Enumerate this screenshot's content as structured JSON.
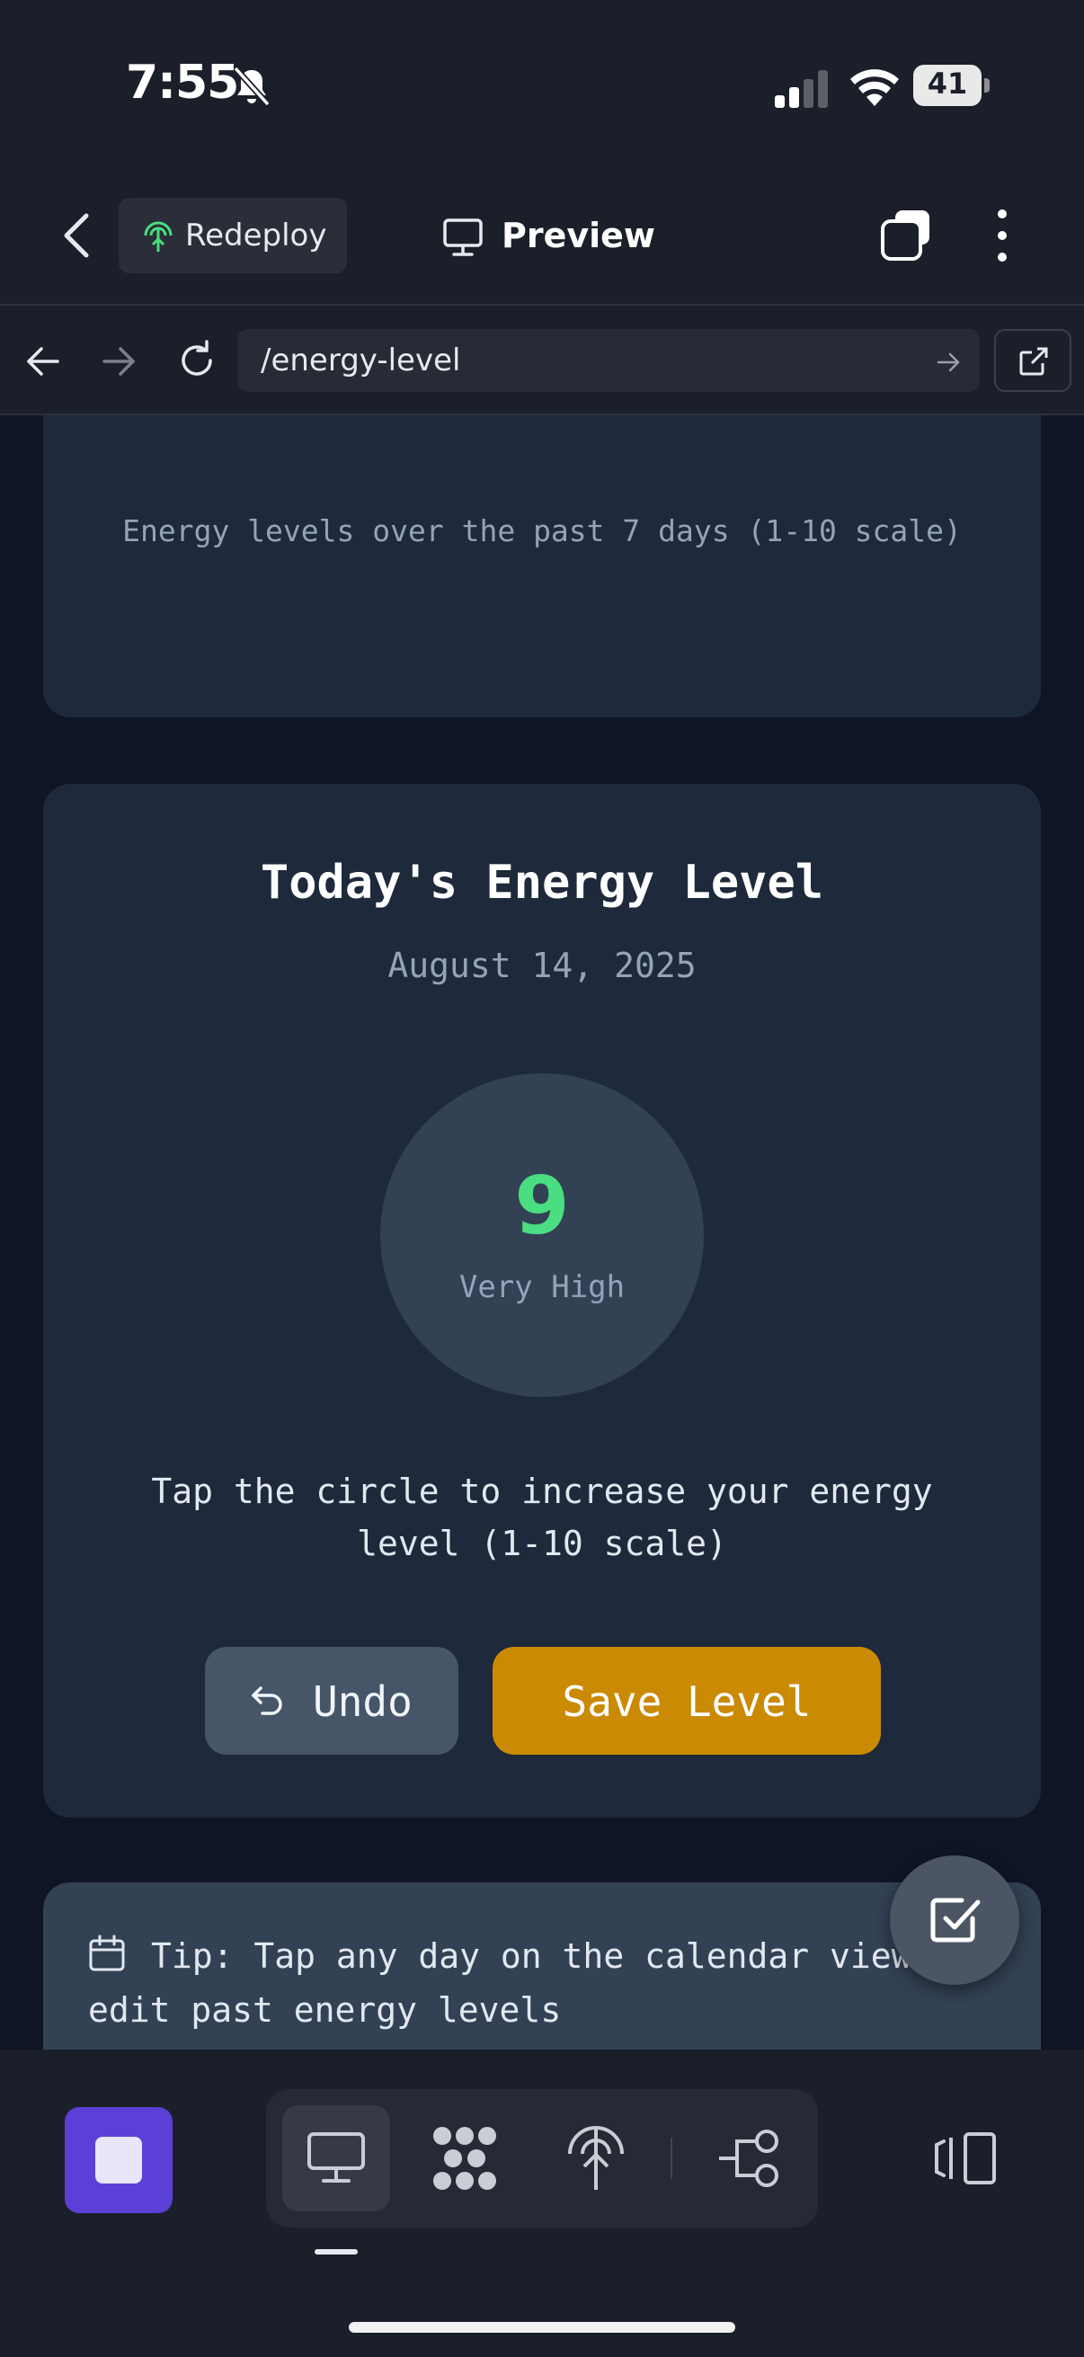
{
  "status_bar": {
    "time": "7:55",
    "battery_level": "41",
    "icons": [
      "bell-off-icon",
      "signal-icon",
      "wifi-icon",
      "battery-icon"
    ]
  },
  "header": {
    "redeploy_label": "Redeploy",
    "preview_label": "Preview",
    "icons": [
      "back-icon",
      "redeploy-icon",
      "monitor-icon",
      "tabs-icon",
      "more-icon"
    ]
  },
  "browser": {
    "url": "/energy-level",
    "icons": [
      "nav-back-icon",
      "nav-forward-icon",
      "reload-icon",
      "url-go-icon",
      "open-external-icon"
    ]
  },
  "chart_card": {
    "placeholders": [
      "-",
      "-",
      "-",
      "-",
      "-",
      "-",
      "-"
    ],
    "caption": "Energy levels over the past 7 days (1-10 scale)"
  },
  "energy_card": {
    "title": "Today's Energy Level",
    "date": "August 14, 2025",
    "value": "9",
    "value_label": "Very High",
    "instruction": "Tap the circle to increase your energy level (1-10 scale)",
    "undo_label": "Undo",
    "save_label": "Save Level",
    "colors": {
      "value": "#4ade80",
      "save_button": "#ca8a04",
      "undo_button": "#475569"
    }
  },
  "tip_card": {
    "text": "Tip: Tap any day on the calendar view or edit past energy levels"
  },
  "toolbar": {
    "icons": [
      "stop-icon",
      "desktop-icon",
      "grid-icon",
      "deploy-icon",
      "flow-icon",
      "panel-icon"
    ],
    "accent": "#5b3fd6"
  }
}
